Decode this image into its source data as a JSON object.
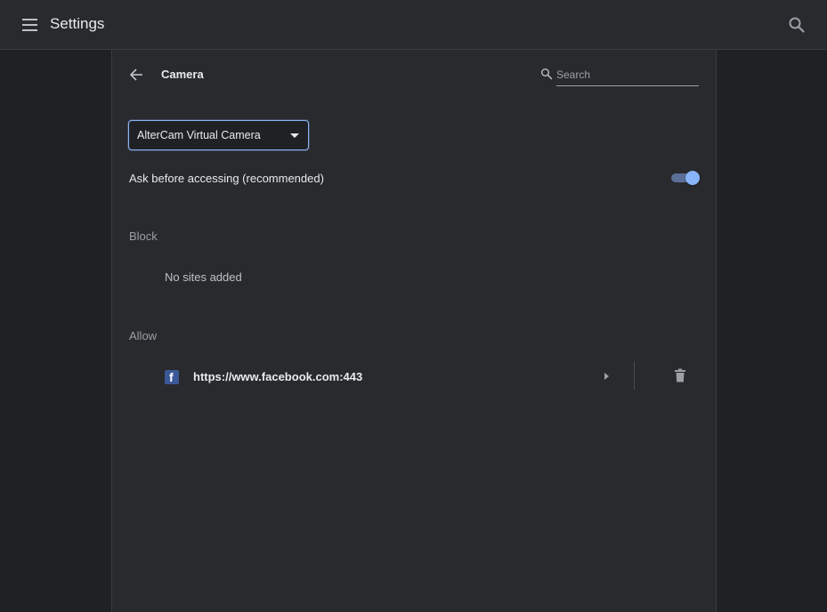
{
  "header": {
    "title": "Settings",
    "menu_icon": "hamburger-menu-icon",
    "search_icon": "search-icon"
  },
  "camera_page": {
    "title": "Camera",
    "back_icon": "arrow-left-icon",
    "search": {
      "placeholder": "Search",
      "value": ""
    },
    "device_select": {
      "selected": "AlterCam Virtual Camera"
    },
    "ask_toggle": {
      "label": "Ask before accessing (recommended)",
      "on": true
    },
    "block": {
      "heading": "Block",
      "empty_text": "No sites added"
    },
    "allow": {
      "heading": "Allow",
      "sites": [
        {
          "url": "https://www.facebook.com:443",
          "favicon": "facebook-icon"
        }
      ]
    }
  },
  "colors": {
    "background": "#202124",
    "panel": "#292a2d",
    "accent": "#8ab4f8",
    "facebook": "#3b5998"
  }
}
